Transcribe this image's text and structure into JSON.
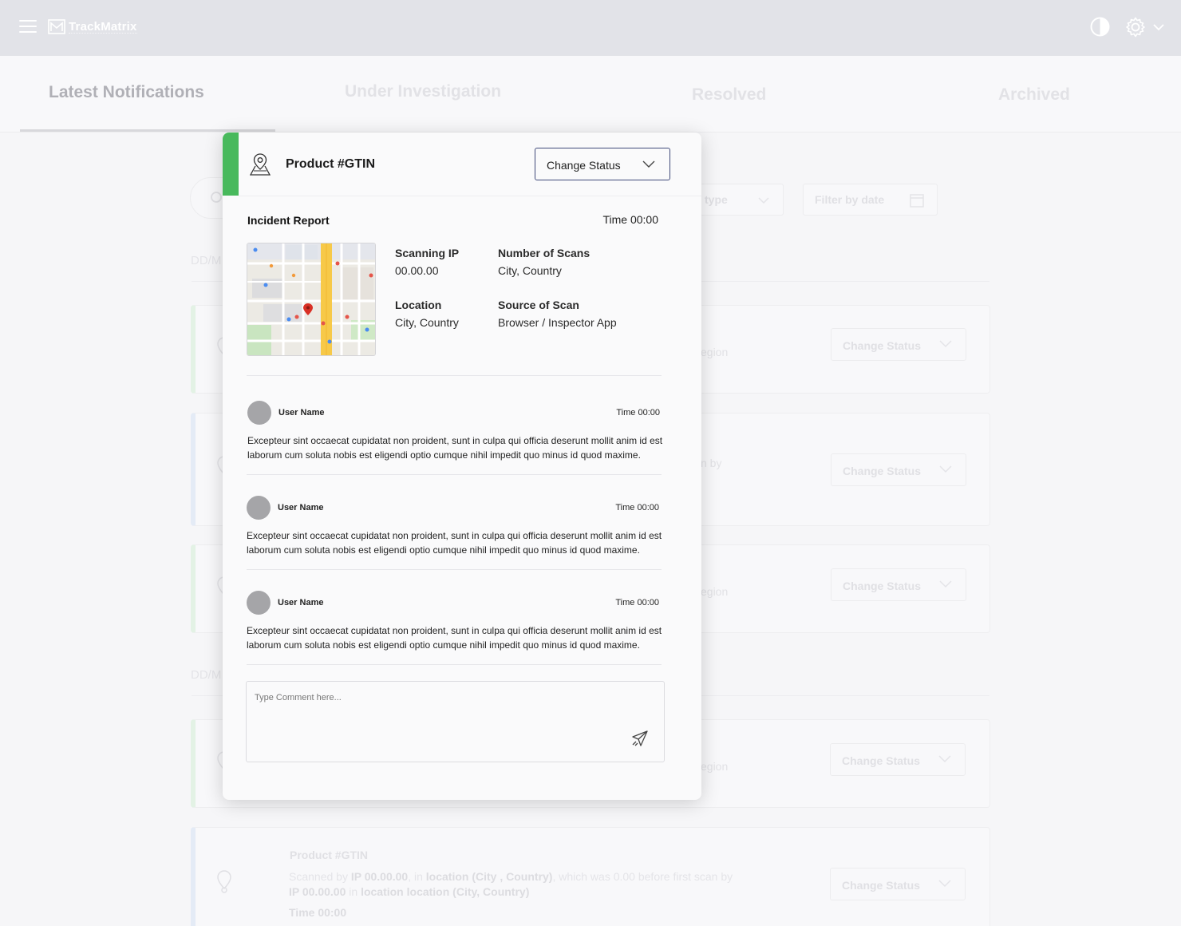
{
  "app": {
    "name": "TrackMatrix"
  },
  "tabs": [
    {
      "label": "Latest Notifications",
      "active": true
    },
    {
      "label": "Under Investigation",
      "active": false
    },
    {
      "label": "Resolved",
      "active": false
    },
    {
      "label": "Archived",
      "active": false
    }
  ],
  "background": {
    "filter_type": "type",
    "filter_date": "Filter by date",
    "date_group_1": "DD/M",
    "date_group_2": "DD/M",
    "cards": [
      {
        "fragment": "egion",
        "status": "Change Status"
      },
      {
        "fragment": "n by",
        "status": "Change Status"
      },
      {
        "fragment": "egion",
        "status": "Change Status"
      },
      {
        "fragment": "egion",
        "status": "Change Status"
      },
      {
        "title": "Product #GTIN",
        "desc_1": "Scanned by ",
        "desc_ip": "IP 00.00.00",
        "desc_2": ", in ",
        "desc_loc": "location (City , Country)",
        "desc_3": ", which was 0.00 before first scan by",
        "desc_ip2": "IP 00.00.00",
        "desc_4": " in ",
        "desc_loc2": "location location (City, Country)",
        "time": "Time 00:00",
        "status": "Change Status"
      }
    ]
  },
  "modal": {
    "title": "Product #GTIN",
    "status_button": "Change Status",
    "report_title": "Incident Report",
    "report_time": "Time 00:00",
    "fields": {
      "scanning_ip_label": "Scanning IP",
      "scanning_ip_value": "00.00.00",
      "scans_label": "Number of Scans",
      "scans_value": "City, Country",
      "location_label": "Location",
      "location_value": "City, Country",
      "source_label": "Source of Scan",
      "source_value": "Browser / Inspector App"
    },
    "comments": [
      {
        "user": "User Name",
        "time": "Time 00:00",
        "text": "Excepteur sint occaecat cupidatat non proident, sunt in culpa qui officia deserunt mollit anim id est laborum cum soluta nobis est eligendi optio cumque nihil impedit quo minus id quod maxime."
      },
      {
        "user": "User Name",
        "time": "Time 00:00",
        "text": "Excepteur sint occaecat cupidatat non proident, sunt in culpa qui officia deserunt mollit anim id est laborum cum soluta nobis est eligendi optio cumque nihil impedit quo minus id quod maxime."
      },
      {
        "user": "User Name",
        "time": "Time 00:00",
        "text": "Excepteur sint occaecat cupidatat non proident, sunt in culpa qui officia deserunt mollit anim id est laborum cum soluta nobis est eligendi optio cumque nihil impedit quo minus id quod maxime."
      }
    ],
    "comment_placeholder": "Type Comment here...",
    "accent_color": "#48b95c"
  }
}
